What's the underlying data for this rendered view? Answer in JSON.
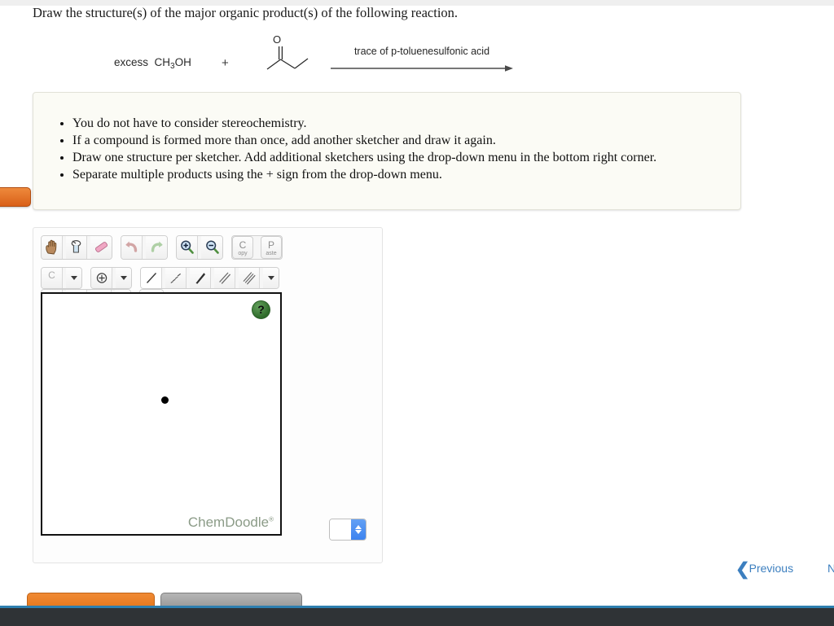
{
  "question": {
    "text": "Draw the structure(s) of the major organic product(s) of the following reaction."
  },
  "reaction": {
    "reagent_prefix": "excess",
    "reagent_formula_pre": "CH",
    "reagent_formula_sub": "3",
    "reagent_formula_post": "OH",
    "plus": "+",
    "substrate_name": "butan-2-one",
    "conditions": "trace of p-toluenesulfonic acid"
  },
  "instructions": {
    "items": [
      "You do not have to consider stereochemistry.",
      "If a compound is formed more than once, add another sketcher and draw it again.",
      "Draw one structure per sketcher. Add additional sketchers using the drop-down menu in the bottom right corner.",
      "Separate multiple products using the + sign from the drop-down menu."
    ]
  },
  "sketcher": {
    "toolbar_row1": [
      {
        "name": "hand-pan-icon",
        "label": ""
      },
      {
        "name": "lasso-select-icon",
        "label": ""
      },
      {
        "name": "eraser-icon",
        "label": ""
      },
      {
        "name": "undo-icon",
        "label": ""
      },
      {
        "name": "redo-icon",
        "label": ""
      },
      {
        "name": "zoom-in-icon",
        "label": ""
      },
      {
        "name": "zoom-out-icon",
        "label": ""
      },
      {
        "name": "copy-button",
        "label_big": "C",
        "label_small": "opy"
      },
      {
        "name": "paste-button",
        "label_big": "P",
        "label_small": "aste"
      }
    ],
    "element_label": "C",
    "toolbar_row2": [
      {
        "name": "element-carbon-button",
        "label": "C"
      },
      {
        "name": "element-dropdown-caret",
        "label": ""
      },
      {
        "name": "charge-plus-icon",
        "label": ""
      },
      {
        "name": "charge-dropdown-caret",
        "label": ""
      },
      {
        "name": "bond-single-icon",
        "label": ""
      },
      {
        "name": "bond-hash-icon",
        "label": ""
      },
      {
        "name": "bond-wedge-icon",
        "label": ""
      },
      {
        "name": "bond-double-icon",
        "label": ""
      },
      {
        "name": "bond-triple-icon",
        "label": ""
      },
      {
        "name": "bond-dropdown-caret",
        "label": ""
      },
      {
        "name": "ring-hexagon-icon",
        "label": ""
      },
      {
        "name": "ring-benzene-icon",
        "label": ""
      },
      {
        "name": "ring-pentagon-icon",
        "label": ""
      },
      {
        "name": "ring-dropdown-caret",
        "label": ""
      },
      {
        "name": "bracket-charge-icon",
        "label": "[ ]±"
      }
    ],
    "bracket_label": "[ ]",
    "bracket_sup": "±",
    "help_label": "?",
    "brand": "ChemDoodle",
    "brand_mark": "®",
    "stepper_value": ""
  },
  "navigation": {
    "previous_label": "Previous",
    "previous_chevron": "❮",
    "next_label": "N"
  },
  "colors": {
    "accent_blue": "#3c7fbf",
    "orange": "#e2751c",
    "brand_green": "#8b9b87",
    "help_green": "#2f6b2b",
    "stepper_blue": "#3d83ef"
  }
}
